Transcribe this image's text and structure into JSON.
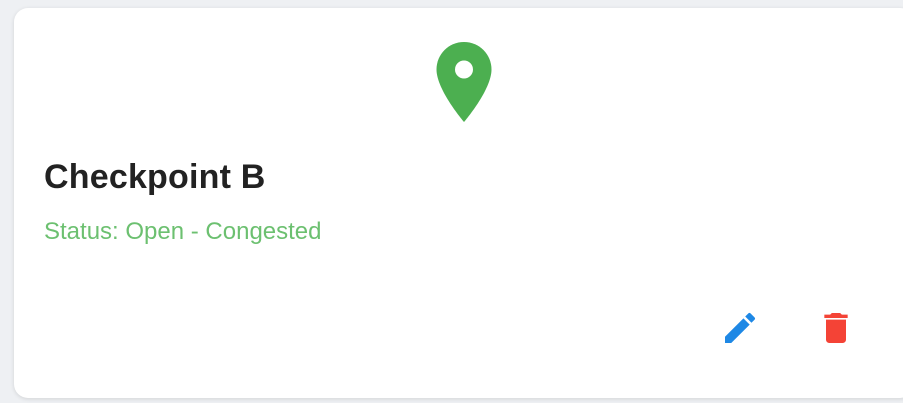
{
  "card": {
    "title": "Checkpoint B",
    "status": "Status: Open - Congested"
  },
  "icons": {
    "location": "location-pin-icon",
    "edit": "pencil-icon",
    "delete": "trash-icon"
  },
  "colors": {
    "pin": "#4caf50",
    "status": "#6cc070",
    "edit": "#1e88e5",
    "delete": "#f44336"
  }
}
